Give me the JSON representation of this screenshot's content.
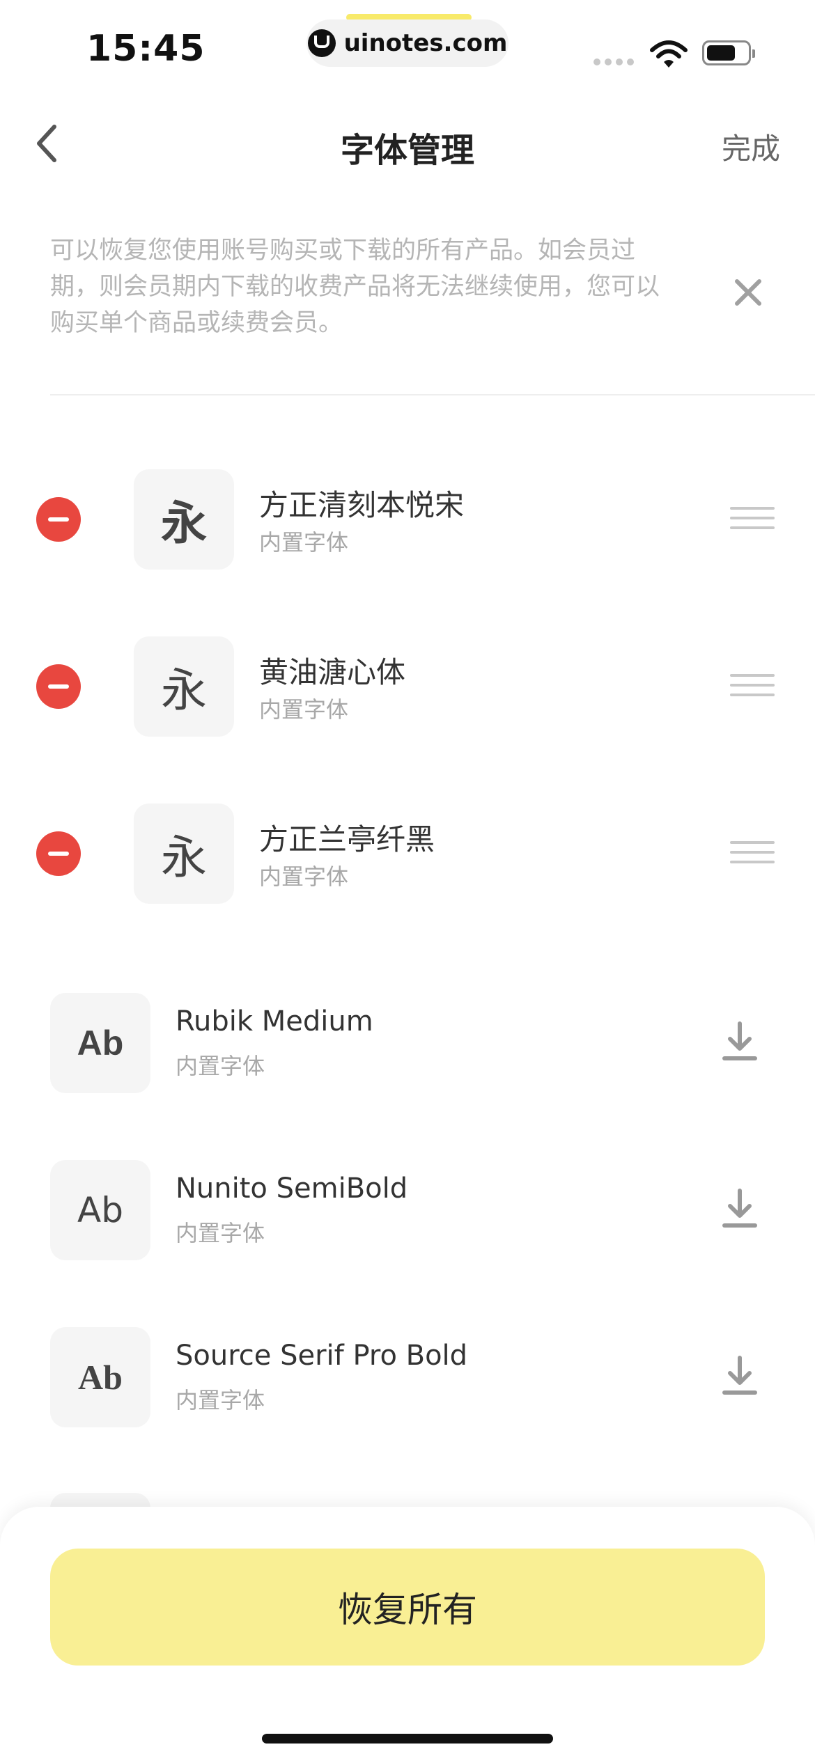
{
  "status_bar": {
    "time": "15:45",
    "url": "uinotes.com"
  },
  "nav": {
    "title": "字体管理",
    "done": "完成"
  },
  "notice": {
    "text": "可以恢复您使用账号购买或下载的所有产品。如会员过期，则会员期内下载的收费产品将无法继续使用，您可以购买单个商品或续费会员。"
  },
  "installed_fonts": [
    {
      "name": "方正清刻本悦宋",
      "tag": "内置字体",
      "glyph": "永"
    },
    {
      "name": "黄油溏心体",
      "tag": "内置字体",
      "glyph": "永"
    },
    {
      "name": "方正兰亭纤黑",
      "tag": "内置字体",
      "glyph": "永"
    }
  ],
  "download_fonts": [
    {
      "name": "Rubik Medium",
      "tag": "内置字体",
      "glyph": "Ab"
    },
    {
      "name": "Nunito SemiBold",
      "tag": "内置字体",
      "glyph": "Ab"
    },
    {
      "name": "Source Serif Pro Bold",
      "tag": "内置字体",
      "glyph": "Ab"
    }
  ],
  "footer": {
    "restore_all": "恢复所有"
  },
  "colors": {
    "accent_yellow": "#f9ef94",
    "remove_red": "#e8473f",
    "muted_text": "#a8a8a8"
  },
  "icons": [
    "back-chevron-icon",
    "close-icon",
    "remove-icon",
    "drag-handle-icon",
    "download-icon",
    "wifi-icon",
    "battery-icon"
  ]
}
